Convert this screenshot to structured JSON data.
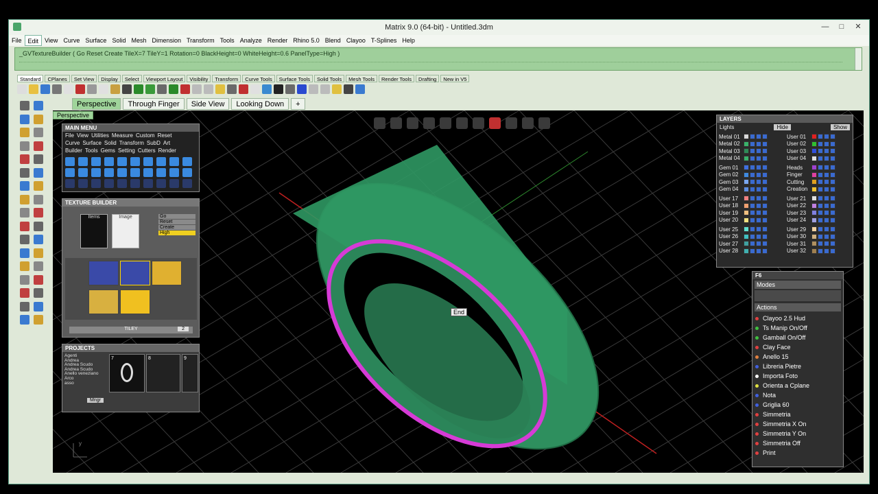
{
  "window": {
    "title": "Matrix 9.0 (64-bit) - Untitled.3dm",
    "minimize": "—",
    "maximize": "□",
    "close": "✕"
  },
  "menu": [
    "File",
    "Edit",
    "View",
    "Curve",
    "Surface",
    "Solid",
    "Mesh",
    "Dimension",
    "Transform",
    "Tools",
    "Analyze",
    "Render",
    "Rhino 5.0",
    "Blend",
    "Clayoo",
    "T-Splines",
    "Help"
  ],
  "command_line": "_GVTextureBuilder ( Go  Reset  Create  TileX=7  TileY=1  Rotation=0  BlackHeight=0  WhiteHeight=0.6  PanelType=High )",
  "toolbar_tabs": [
    "Standard",
    "CPlanes",
    "Set View",
    "Display",
    "Select",
    "Viewport Layout",
    "Visibility",
    "Transform",
    "Curve Tools",
    "Surface Tools",
    "Solid Tools",
    "Mesh Tools",
    "Render Tools",
    "Drafting",
    "New in V5"
  ],
  "viewport_tabs": [
    "Perspective",
    "Through Finger",
    "Side View",
    "Looking Down"
  ],
  "viewport_label": "Perspective",
  "snap_tooltip": "End",
  "main_menu": {
    "title": "MAIN MENU",
    "row1": [
      "File",
      "View",
      "Utilities",
      "Measure",
      "Custom",
      "Reset"
    ],
    "row2": [
      "Curve",
      "Surface",
      "Solid",
      "Transform",
      "SubD",
      "Art"
    ],
    "row3": [
      "Builder",
      "Tools",
      "Gems",
      "Setting",
      "Cutters",
      "Render"
    ]
  },
  "texture_builder": {
    "title": "TEXTURE BUILDER",
    "items_label": "Items",
    "image_label": "Image",
    "options": [
      "Go",
      "Reset",
      "Create",
      "High"
    ],
    "tiley_label": "TILEY",
    "tiley_value": "2"
  },
  "projects": {
    "title": "PROJECTS",
    "names": [
      "Agenti",
      "Andrea",
      "Andrea Scudo",
      "Andrea Scudo",
      "Anello veneziano",
      "Arco",
      "asso"
    ],
    "cols": [
      "7",
      "8",
      "9"
    ],
    "button": "Mngr"
  },
  "layers": {
    "title": "LAYERS",
    "lights": "Lights",
    "hide": "Hide",
    "show": "Show",
    "left": [
      "Metal 01",
      "Metal 02",
      "Metal 03",
      "Metal 04",
      "Gem 01",
      "Gem 02",
      "Gem 03",
      "Gem 04",
      "User 17",
      "User 18",
      "User 19",
      "User 20",
      "User 25",
      "User 26",
      "User 27",
      "User 28"
    ],
    "right": [
      "User 01",
      "User 02",
      "User 03",
      "User 04",
      "Heads",
      "Finger",
      "Cutting",
      "Creation",
      "User 21",
      "User 22",
      "User 23",
      "User 24",
      "User 29",
      "User 30",
      "User 31",
      "User 32"
    ],
    "left_colors": [
      "#d9d9d9",
      "#3ab36a",
      "#2e8b57",
      "#3ab36a",
      "#3f6fe0",
      "#3f8ae0",
      "#7aa7f0",
      "#5d8de0",
      "#f08080",
      "#f0a070",
      "#f0c080",
      "#f0e080",
      "#60e0d0",
      "#40c0c0",
      "#40a0a0",
      "#40b0b0"
    ],
    "right_colors": [
      "#e02020",
      "#30c030",
      "#3050e0",
      "#e0e0e0",
      "#a040d0",
      "#e040a0",
      "#e0a020",
      "#f0c030",
      "#e0e0e0",
      "#c080e0",
      "#8080e0",
      "#a0a0e0",
      "#f0d0a0",
      "#d0b080",
      "#b09060",
      "#a08050"
    ]
  },
  "f6": {
    "title": "F6",
    "modes": "Modes",
    "actions": "Actions",
    "items": [
      {
        "label": "Clayoo 2.5 Hud",
        "color": "#e04040"
      },
      {
        "label": "Ts Manip On/Off",
        "color": "#40c040"
      },
      {
        "label": "Gamball   On/Off",
        "color": "#40c040"
      },
      {
        "label": "Clay Face",
        "color": "#e04040"
      },
      {
        "label": "Anello 15",
        "color": "#e08040"
      },
      {
        "label": "Libreria Pietre",
        "color": "#4060e0"
      },
      {
        "label": "Importa Foto",
        "color": "#ffffff"
      },
      {
        "label": "Orienta a Cplane",
        "color": "#e0e040"
      },
      {
        "label": "Nota",
        "color": "#4060e0"
      },
      {
        "label": "Griglia 60",
        "color": "#4060e0"
      },
      {
        "label": "Simmetria",
        "color": "#e04040"
      },
      {
        "label": "Simmetria X On",
        "color": "#e04040"
      },
      {
        "label": "Simmetria Y On",
        "color": "#e04040"
      },
      {
        "label": "Simmetria Off",
        "color": "#e04040"
      },
      {
        "label": "Print",
        "color": "#e04040"
      }
    ]
  }
}
